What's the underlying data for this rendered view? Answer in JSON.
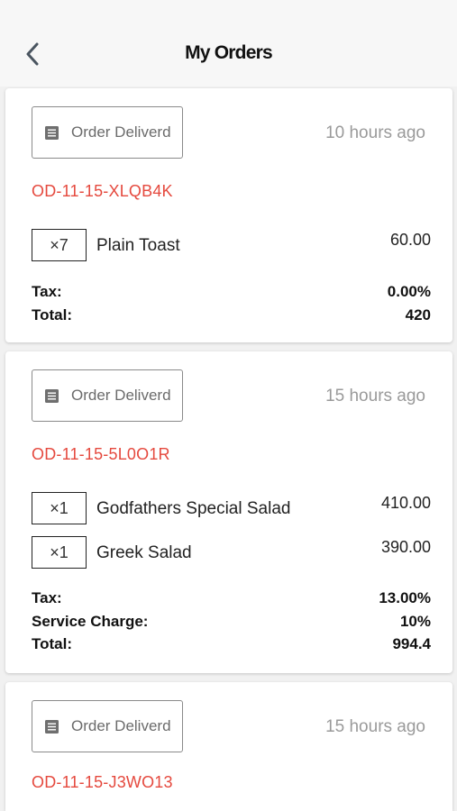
{
  "header": {
    "title": "My Orders"
  },
  "orders": [
    {
      "status": "Order Deliverd",
      "time": "10 hours ago",
      "id": "OD-11-15-XLQB4K",
      "items": [
        {
          "qty": "×7",
          "name": "Plain Toast",
          "price": "60.00"
        }
      ],
      "summary": [
        {
          "label": "Tax:",
          "value": "0.00%"
        },
        {
          "label": "Total:",
          "value": "420"
        }
      ]
    },
    {
      "status": "Order Deliverd",
      "time": "15 hours ago",
      "id": "OD-11-15-5L0O1R",
      "items": [
        {
          "qty": "×1",
          "name": "Godfathers Special Salad",
          "price": "410.00"
        },
        {
          "qty": "×1",
          "name": "Greek Salad",
          "price": "390.00"
        }
      ],
      "summary": [
        {
          "label": "Tax:",
          "value": "13.00%"
        },
        {
          "label": "Service Charge:",
          "value": "10%"
        },
        {
          "label": "Total:",
          "value": "994.4"
        }
      ]
    },
    {
      "status": "Order Deliverd",
      "time": "15 hours ago",
      "id": "OD-11-15-J3WO13",
      "items": [],
      "summary": []
    }
  ]
}
